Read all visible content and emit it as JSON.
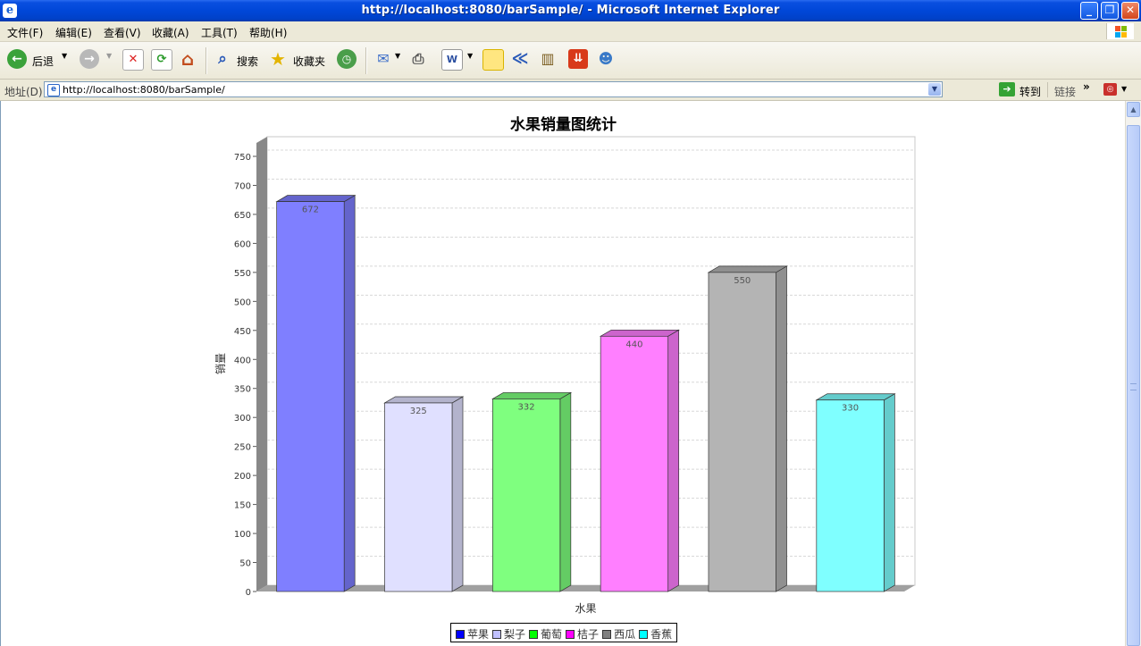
{
  "window": {
    "title": "http://localhost:8080/barSample/ - Microsoft Internet Explorer",
    "icon": "ie-logo-icon",
    "controls": [
      "minimize",
      "maximize",
      "close"
    ]
  },
  "menu": [
    "文件(F)",
    "编辑(E)",
    "查看(V)",
    "收藏(A)",
    "工具(T)",
    "帮助(H)"
  ],
  "toolbar": {
    "back_label": "后退",
    "search_label": "搜索",
    "favorites_label": "收藏夹"
  },
  "address": {
    "label": "地址(D)",
    "url": "http://localhost:8080/barSample/",
    "go_label": "转到",
    "links_label": "链接",
    "links_chevron": "»"
  },
  "chart_data": {
    "type": "bar",
    "title": "水果销量图统计",
    "xlabel": "水果",
    "ylabel": "销量",
    "ylim": [
      0,
      750
    ],
    "yticks": [
      0,
      50,
      100,
      150,
      200,
      250,
      300,
      350,
      400,
      450,
      500,
      550,
      600,
      650,
      700,
      750
    ],
    "grid": true,
    "legend_position": "bottom",
    "categories": [
      "苹果",
      "梨子",
      "葡萄",
      "桔子",
      "西瓜",
      "香蕉"
    ],
    "values": [
      672,
      325,
      332,
      440,
      550,
      330
    ],
    "colors": [
      "#7f7fff",
      "#e0e0ff",
      "#7fff7f",
      "#ff7fff",
      "#b4b4b4",
      "#7fffff"
    ],
    "side_colors": [
      "#6464cc",
      "#b3b3cc",
      "#64cc64",
      "#cc64cc",
      "#909090",
      "#64cccc"
    ],
    "legend_colors": [
      "#0000ff",
      "#c0c0ff",
      "#00ff00",
      "#ff00ff",
      "#808080",
      "#00ffff"
    ],
    "labels": [
      "672",
      "325",
      "332",
      "440",
      "550",
      "330"
    ]
  }
}
